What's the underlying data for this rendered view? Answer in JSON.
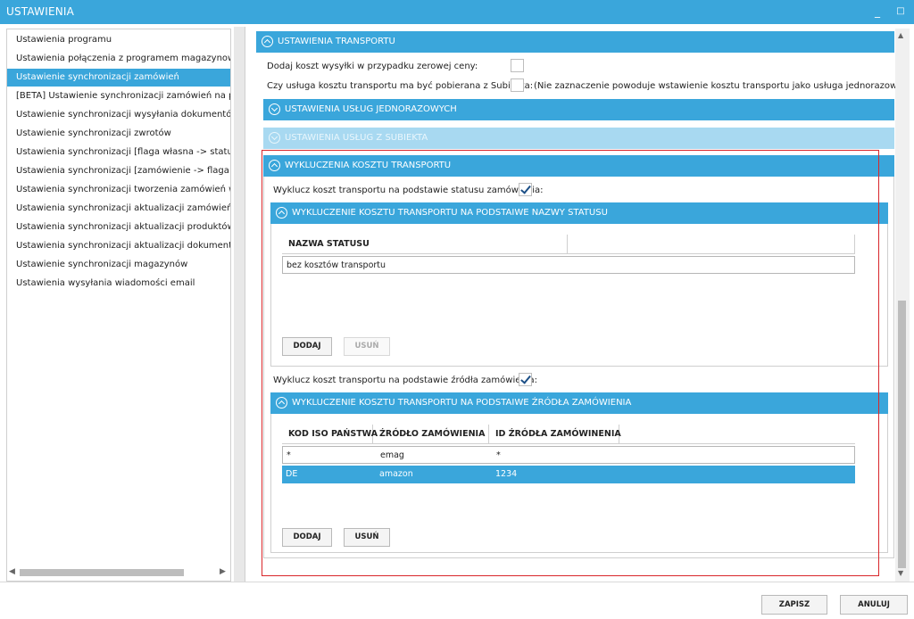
{
  "window": {
    "title": "USTAWIENIA",
    "minimize_glyph": "_",
    "maximize_glyph": "□"
  },
  "nav": {
    "items": [
      "Ustawienia programu",
      "Ustawienia połączenia z programem magazynowym",
      "Ustawienie synchronizacji zamówień",
      "[BETA] Ustawienie synchronizacji zamówień na podsta",
      "Ustawienie synchronizacji wysyłania dokumentów",
      "Ustawienie synchronizacji zwrotów",
      "Ustawienia synchronizacji [flaga własna -> status]",
      "Ustawienia synchronizacji [zamówienie -> flaga własn",
      "Ustawienia synchronizacji tworzenia zamówień w Base",
      "Ustawienia synchronizacji aktualizacji zamówień w Bas",
      "Ustawienia synchronizacji aktualizacji produktów w Ba",
      "Ustawienia synchronizacji aktualizacji dokumentów",
      "Ustawienie synchronizacji magazynów",
      "Ustawienia wysyłania wiadomości email"
    ],
    "selected_index": 2,
    "scroll_left_glyph": "◀",
    "scroll_right_glyph": "▶"
  },
  "transport": {
    "header": "USTAWIENIA TRANSPORTU",
    "add_cost_label": "Dodaj koszt wysyłki w przypadku zerowej ceny:",
    "add_cost_checked": false,
    "charge_label": "Czy usługa kosztu transportu ma być pobierana z Subiekta:",
    "charge_checked": false,
    "charge_note": "(Nie zaznaczenie powoduje wstawienie kosztu transportu jako usługa jednorazowa)"
  },
  "one_time_services": {
    "header": "USTAWIENIA USŁUG JEDNORAZOWYCH"
  },
  "subiekt_services": {
    "header": "USTAWIENIA USŁUG Z SUBIEKTA"
  },
  "exclusions": {
    "header": "WYKLUCZENIA KOSZTU TRANSPORTU",
    "by_status_label": "Wyklucz koszt transportu na podstawie statusu zamówienia:",
    "by_status_checked": true,
    "by_status_panel": {
      "header": "WYKLUCZENIE KOSZTU TRANSPORTU NA PODSTAIWE NAZWY STATUSU",
      "columns": [
        "NAZWA STATUSU",
        ""
      ],
      "rows": [
        [
          "bez kosztów transportu"
        ]
      ],
      "add_button": "DODAJ",
      "remove_button": "USUŃ"
    },
    "by_source_label": "Wyklucz koszt transportu na podstawie źródła zamówienia:",
    "by_source_checked": true,
    "by_source_panel": {
      "header": "WYKLUCZENIE KOSZTU TRANSPORTU NA PODSTAIWE ŹRÓDŁA ZAMÓWIENIA",
      "columns": [
        "KOD ISO PAŃSTWA",
        "ŹRÓDŁO ZAMÓWIENIA",
        "ID ŹRÓDŁA ZAMÓWINENIA"
      ],
      "rows": [
        [
          "*",
          "emag",
          "*"
        ],
        [
          "DE",
          "amazon",
          "1234"
        ]
      ],
      "selected_row": 1,
      "add_button": "DODAJ",
      "remove_button": "USUŃ"
    }
  },
  "vscroll": {
    "up_glyph": "▲",
    "down_glyph": "▼"
  },
  "footer": {
    "save_button": "ZAPISZ",
    "cancel_button": "ANULUJ"
  },
  "colors": {
    "accent": "#3aa6db",
    "accent_light": "#a8d9f1",
    "highlight": "#d9262a"
  }
}
